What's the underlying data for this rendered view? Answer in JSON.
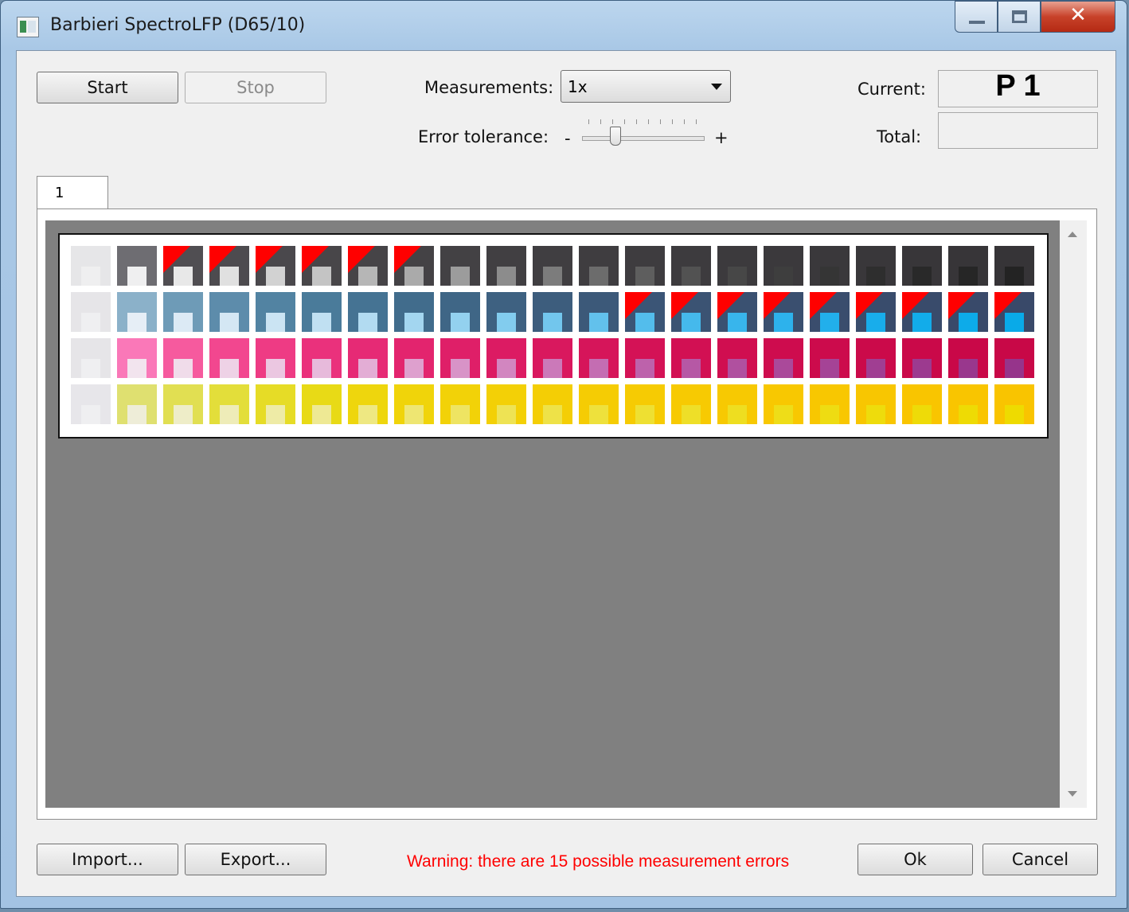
{
  "window": {
    "title": "Barbieri SpectroLFP (D65/10)",
    "controls": {
      "close_glyph": "✕"
    }
  },
  "toolbar": {
    "start_label": "Start",
    "stop_label": "Stop",
    "measurements_label": "Measurements:",
    "measurements_value": "1x",
    "error_tolerance_label": "Error tolerance:",
    "slider_minus": "-",
    "slider_plus": "+",
    "slider_ticks": 10,
    "error_tolerance_position": 0.25,
    "current_label": "Current:",
    "current_value": "P 1",
    "total_label": "Total:",
    "total_value": ""
  },
  "tabs": [
    {
      "label": "1"
    }
  ],
  "patch_chart": {
    "rows": [
      {
        "outer": [
          "#e6e6e8",
          "#6e6d72",
          "#504e52",
          "#4d4b4f",
          "#4a484c",
          "#484649",
          "#464447",
          "#444245",
          "#434144",
          "#413f42",
          "#403e41",
          "#3f3d40",
          "#3e3c3f",
          "#3d3b3e",
          "#3c3a3d",
          "#3b393c",
          "#3a383b",
          "#39373a",
          "#383639",
          "#373538",
          "#363437"
        ],
        "inner": [
          "#efeff0",
          "#efeff0",
          "#e8e8e8",
          "#e0e0e0",
          "#d2d2d2",
          "#c4c4c4",
          "#b6b6b6",
          "#aaaaaa",
          "#9c9c9c",
          "#8c8c8c",
          "#7c7c7c",
          "#6c6c6c",
          "#5e5e5e",
          "#525252",
          "#474747",
          "#3e3e3e",
          "#353535",
          "#2e2e2e",
          "#292929",
          "#262626",
          "#232323"
        ],
        "flags": [
          false,
          false,
          true,
          true,
          true,
          true,
          true,
          true,
          false,
          false,
          false,
          false,
          false,
          false,
          false,
          false,
          false,
          false,
          false,
          false,
          false
        ]
      },
      {
        "outer": [
          "#e6e5e8",
          "#8bb1c9",
          "#6e9bb7",
          "#5d8cab",
          "#5283a2",
          "#4a7b9a",
          "#457393",
          "#416c8c",
          "#3f6686",
          "#3e6181",
          "#3d5d7d",
          "#3c5979",
          "#3b5576",
          "#3b5373",
          "#3a5171",
          "#3a4f6f",
          "#3a4d6d",
          "#394c6c",
          "#394b6b",
          "#394a6a",
          "#394969"
        ],
        "inner": [
          "#efeff1",
          "#e6eef6",
          "#dceaf5",
          "#d4e7f4",
          "#cbe4f3",
          "#c0e0f2",
          "#b2dbf1",
          "#a3d6f0",
          "#93d1ef",
          "#82ccee",
          "#72c6ed",
          "#62c1ec",
          "#53bdec",
          "#45b9ec",
          "#38b5ec",
          "#2db2ec",
          "#22afeb",
          "#18adeb",
          "#12acea",
          "#0dabe9",
          "#09aae8"
        ],
        "flags": [
          false,
          false,
          false,
          false,
          false,
          false,
          false,
          false,
          false,
          false,
          false,
          false,
          true,
          true,
          true,
          true,
          true,
          true,
          true,
          true,
          true
        ]
      },
      {
        "outer": [
          "#e6e5e8",
          "#fa78b8",
          "#f65a9e",
          "#f2478f",
          "#ee3b84",
          "#ea317c",
          "#e62a75",
          "#e3246e",
          "#df1f68",
          "#dc1b63",
          "#d9185e",
          "#d6155a",
          "#d41256",
          "#d21053",
          "#d00e50",
          "#ce0c4e",
          "#cc0b4c",
          "#cb0a4a",
          "#ca0949",
          "#c90848",
          "#c80847"
        ],
        "inner": [
          "#efeff1",
          "#f2e4ee",
          "#f0dcea",
          "#eed2e6",
          "#ebc7e1",
          "#e7badb",
          "#e3add5",
          "#dea0ce",
          "#d893c7",
          "#d286c0",
          "#cb79b9",
          "#c46db2",
          "#bd62ab",
          "#b658a5",
          "#b0509f",
          "#aa499a",
          "#a54396",
          "#a03e92",
          "#9c3a8f",
          "#99378d",
          "#96348b"
        ],
        "flags": [
          false,
          false,
          false,
          false,
          false,
          false,
          false,
          false,
          false,
          false,
          false,
          false,
          false,
          false,
          false,
          false,
          false,
          false,
          false,
          false,
          false
        ]
      },
      {
        "outer": [
          "#e7e6ea",
          "#dfe070",
          "#e1df52",
          "#e3de3a",
          "#e6dc26",
          "#e8da16",
          "#eed60d",
          "#f0d40a",
          "#f2d208",
          "#f3d006",
          "#f4ce05",
          "#f5cc04",
          "#f6cb03",
          "#f7ca02",
          "#f7c902",
          "#f8c801",
          "#f8c701",
          "#f8c601",
          "#f9c500",
          "#f9c500",
          "#f9c400"
        ],
        "inner": [
          "#efeff1",
          "#eeedd8",
          "#eeedc8",
          "#eeecb8",
          "#eeeba6",
          "#eee994",
          "#eee882",
          "#eee672",
          "#eee462",
          "#eee354",
          "#eee248",
          "#eee13c",
          "#eee032",
          "#eedf28",
          "#eede20",
          "#eedd18",
          "#eedc12",
          "#eedc0c",
          "#eedb08",
          "#eedb04",
          "#eedb00"
        ],
        "flags": [
          false,
          false,
          false,
          false,
          false,
          false,
          false,
          false,
          false,
          false,
          false,
          false,
          false,
          false,
          false,
          false,
          false,
          false,
          false,
          false,
          false
        ]
      }
    ]
  },
  "footer": {
    "import_label": "Import...",
    "export_label": "Export...",
    "warning_text": "Warning: there are 15 possible measurement errors",
    "warning_color": "#ff0000",
    "ok_label": "Ok",
    "cancel_label": "Cancel"
  }
}
